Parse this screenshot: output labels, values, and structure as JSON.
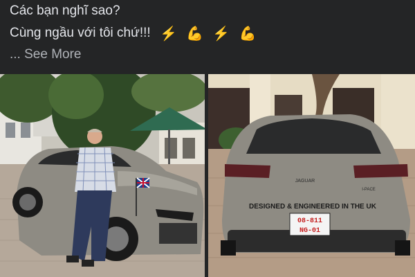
{
  "post": {
    "line1": "Các bạn nghĩ sao?",
    "line2": "Cùng ngầu với tôi chứ!!!",
    "emojis": [
      "⚡",
      "💪",
      "⚡",
      "💪"
    ],
    "ellipsis": "...",
    "see_more": "See More"
  },
  "photos": {
    "right": {
      "badge_text": "DESIGNED & ENGINEERED IN THE UK",
      "plate_line1": "08-811",
      "plate_line2": "NG-01",
      "brand": "JAGUAR",
      "model": "I-PACE"
    }
  },
  "colors": {
    "background": "#242526",
    "text": "#e4e6eb",
    "muted": "#b0b3b8",
    "car_body": "#8e8b83"
  }
}
